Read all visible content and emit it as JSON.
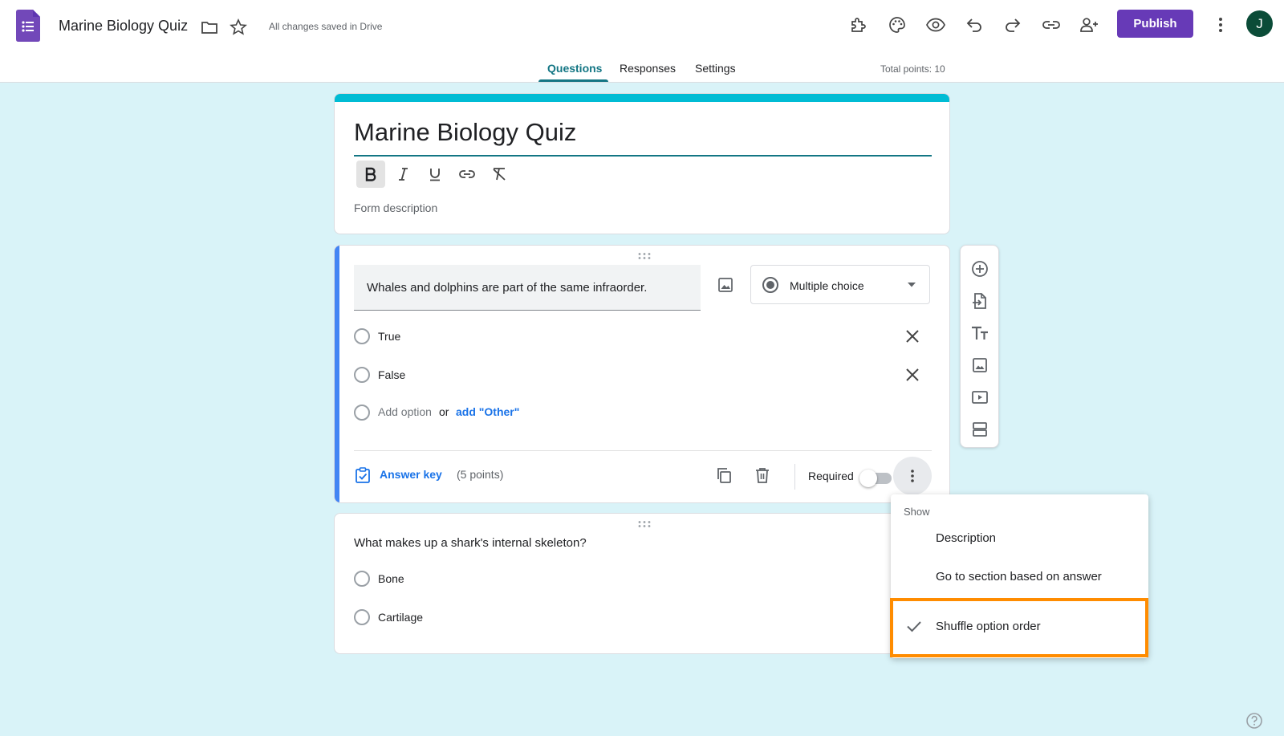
{
  "header": {
    "doc_title": "Marine Biology Quiz",
    "saved_status": "All changes saved in Drive",
    "publish_label": "Publish",
    "avatar_initial": "J"
  },
  "tabs": [
    {
      "label": "Questions",
      "active": true
    },
    {
      "label": "Responses",
      "active": false
    },
    {
      "label": "Settings",
      "active": false
    }
  ],
  "total_points": "Total points: 10",
  "form": {
    "title": "Marine Biology Quiz",
    "description_placeholder": "Form description"
  },
  "question1": {
    "text": "Whales and dolphins are part of the same infraorder.",
    "type": "Multiple choice",
    "options": [
      "True",
      "False"
    ],
    "add_option": "Add option",
    "or": "or",
    "add_other": "add \"Other\"",
    "answer_key": "Answer key",
    "points": "(5 points)",
    "required_label": "Required",
    "required": false
  },
  "question2": {
    "text": "What makes up a shark's internal skeleton?",
    "options": [
      "Bone",
      "Cartilage"
    ]
  },
  "menu": {
    "header": "Show",
    "items": [
      {
        "label": "Description",
        "checked": false
      },
      {
        "label": "Go to section based on answer",
        "checked": false
      },
      {
        "label": "Shuffle option order",
        "checked": true
      }
    ]
  },
  "colors": {
    "theme": "#673ab7",
    "accent": "#137684",
    "header_bar": "#00bcd4",
    "highlight": "#ff8c00",
    "background": "#d9f3f8"
  }
}
